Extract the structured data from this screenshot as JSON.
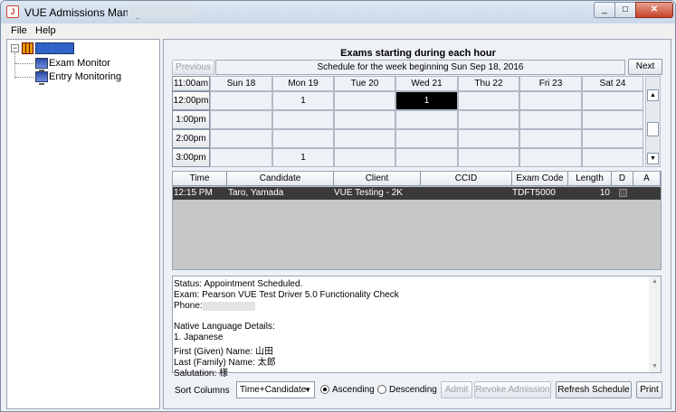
{
  "window": {
    "title": "VUE Admissions Manager",
    "title_icon_glyph": "J",
    "minimize_glyph": "_",
    "maximize_glyph": "□",
    "close_glyph": "✕"
  },
  "menu": {
    "items": [
      "File",
      "Help"
    ]
  },
  "tree": {
    "toggle_glyph": "−",
    "root_icon": "calendar-grid-icon",
    "children": [
      {
        "label": "Exam Monitor",
        "icon": "monitor-icon"
      },
      {
        "label": "Entry Monitoring",
        "icon": "monitor-icon"
      }
    ]
  },
  "calendar": {
    "title": "Exams starting during each hour",
    "previous_label": "Previous",
    "next_label": "Next",
    "week_label": "Schedule for the week beginning Sun Sep 18, 2016",
    "corner_label": "11:00am",
    "days": [
      "Sun 18",
      "Mon 19",
      "Tue 20",
      "Wed 21",
      "Thu 22",
      "Fri 23",
      "Sat 24"
    ],
    "rows": [
      {
        "time": "12:00pm",
        "cells": [
          "",
          "1",
          "",
          "1",
          "",
          "",
          ""
        ]
      },
      {
        "time": "1:00pm",
        "cells": [
          "",
          "",
          "",
          "",
          "",
          "",
          ""
        ]
      },
      {
        "time": "2:00pm",
        "cells": [
          "",
          "",
          "",
          "",
          "",
          "",
          ""
        ]
      },
      {
        "time": "3:00pm",
        "cells": [
          "",
          "1",
          "",
          "",
          "",
          "",
          ""
        ]
      }
    ],
    "scroll_up_glyph": "▲",
    "scroll_down_glyph": "▼"
  },
  "table": {
    "headers": [
      "Time",
      "Candidate",
      "Client",
      "CCID",
      "Exam Code",
      "Length",
      "D",
      "A"
    ],
    "rows": [
      {
        "time": "12:15 PM",
        "candidate": "Taro, Yamada",
        "client": "VUE Testing - 2K",
        "ccid": "",
        "exam_code": "TDFT5000",
        "length": "10",
        "d_checked": false
      }
    ]
  },
  "details": {
    "status": "Status: Appointment Scheduled.",
    "exam": "Exam: Pearson VUE Test Driver 5.0 Functionality Check",
    "phone": "Phone:",
    "native_language_header": "Native Language Details:",
    "language": "1. Japanese",
    "first_name": "First (Given) Name: 山田",
    "last_name": "Last (Family) Name: 太郎",
    "salutation": "Salutation: 様",
    "scroll_up_glyph": "▲",
    "scroll_down_glyph": "▼"
  },
  "controls": {
    "sort_label": "Sort Columns",
    "sort_value": "Time+Candidate",
    "sort_arrow": "▼",
    "ascending_label": "Ascending",
    "descending_label": "Descending",
    "admit_label": "Admit",
    "revoke_label": "Revoke Admission",
    "refresh_label": "Refresh Schedule",
    "print_label": "Print"
  }
}
